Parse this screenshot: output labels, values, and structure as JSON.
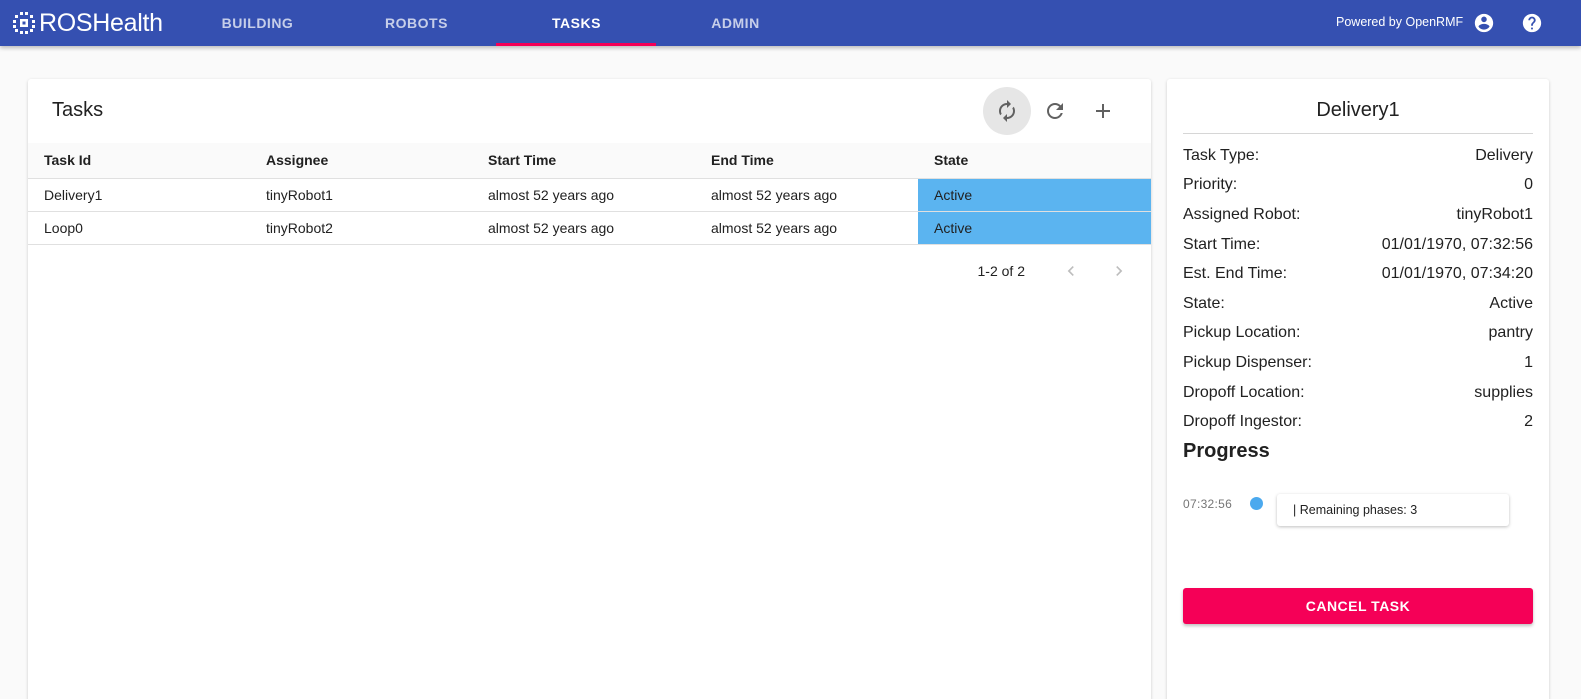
{
  "appbar": {
    "brand": "ROSHealth",
    "tabs": [
      {
        "label": "BUILDING",
        "active": false
      },
      {
        "label": "ROBOTS",
        "active": false
      },
      {
        "label": "TASKS",
        "active": true
      },
      {
        "label": "ADMIN",
        "active": false
      }
    ],
    "powered_by": "Powered by OpenRMF",
    "icons": [
      "account-circle-icon",
      "help-circle-icon"
    ]
  },
  "tasks": {
    "title": "Tasks",
    "toolbar_icons": [
      "autorenew-icon",
      "refresh-icon",
      "add-icon"
    ],
    "columns": [
      "Task Id",
      "Assignee",
      "Start Time",
      "End Time",
      "State"
    ],
    "rows": [
      [
        "Delivery1",
        "tinyRobot1",
        "almost 52 years ago",
        "almost 52 years ago",
        "Active"
      ],
      [
        "Loop0",
        "tinyRobot2",
        "almost 52 years ago",
        "almost 52 years ago",
        "Active"
      ]
    ],
    "pagination": "1-2 of 2"
  },
  "detail": {
    "title": "Delivery1",
    "rows": [
      {
        "label": "Task Type:",
        "value": "Delivery"
      },
      {
        "label": "Priority:",
        "value": "0"
      },
      {
        "label": "Assigned Robot:",
        "value": "tinyRobot1"
      },
      {
        "label": "Start Time:",
        "value": "01/01/1970, 07:32:56"
      },
      {
        "label": "Est. End Time:",
        "value": "01/01/1970, 07:34:20"
      },
      {
        "label": "State:",
        "value": "Active"
      },
      {
        "label": "Pickup Location:",
        "value": "pantry"
      },
      {
        "label": "Pickup Dispenser:",
        "value": "1"
      },
      {
        "label": "Dropoff Location:",
        "value": "supplies"
      },
      {
        "label": "Dropoff Ingestor:",
        "value": "2"
      }
    ],
    "progress_title": "Progress",
    "timeline": {
      "time": "07:32:56",
      "text": "| Remaining phases: 3"
    },
    "cancel_label": "CANCEL TASK"
  },
  "colors": {
    "appbar": "#3550b1",
    "accent": "#f50057",
    "state_active": "#5bb4f0",
    "timeline_dot": "#4ba9ee"
  }
}
